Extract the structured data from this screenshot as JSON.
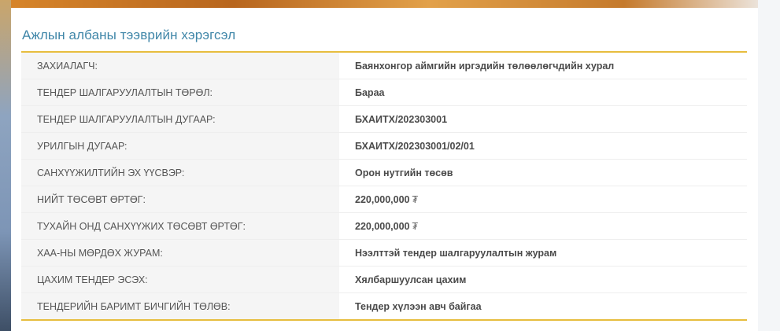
{
  "section": {
    "title": "Ажлын албаны тээврийн хэрэгсэл"
  },
  "rows": [
    {
      "label": "ЗАХИАЛАГЧ:",
      "value": "Баянхонгор аймгийн иргэдийн төлөөлөгчдийн хурал"
    },
    {
      "label": "ТЕНДЕР ШАЛГАРУУЛАЛТЫН ТӨРӨЛ:",
      "value": "Бараа"
    },
    {
      "label": "ТЕНДЕР ШАЛГАРУУЛАЛТЫН ДУГААР:",
      "value": "БХАИТХ/202303001"
    },
    {
      "label": "УРИЛГЫН ДУГААР:",
      "value": "БХАИТХ/202303001/02/01"
    },
    {
      "label": "САНХҮҮЖИЛТИЙН ЭХ ҮҮСВЭР:",
      "value": "Орон нутгийн төсөв"
    },
    {
      "label": "НИЙТ ТӨСӨВТ ӨРТӨГ:",
      "value": "220,000,000",
      "currency": "₮"
    },
    {
      "label": "ТУХАЙН ОНД САНХҮҮЖИХ ТӨСӨВТ ӨРТӨГ:",
      "value": "220,000,000",
      "currency": "₮"
    },
    {
      "label": "ХАА-НЫ МӨРДӨХ ЖУРАМ:",
      "value": "Нээлттэй тендер шалгаруулалтын журам"
    },
    {
      "label": "ЦАХИМ ТЕНДЕР ЭСЭХ:",
      "value": "Хялбаршуулсан цахим"
    },
    {
      "label": "ТЕНДЕРИЙН БАРИМТ БИЧГИЙН ТӨЛӨВ:",
      "value": "Тендер хүлээн авч байгаа"
    }
  ],
  "colors": {
    "title": "#3f86a8",
    "table_border_accent": "#e7bd3e",
    "label_background": "#f5f5f5"
  }
}
